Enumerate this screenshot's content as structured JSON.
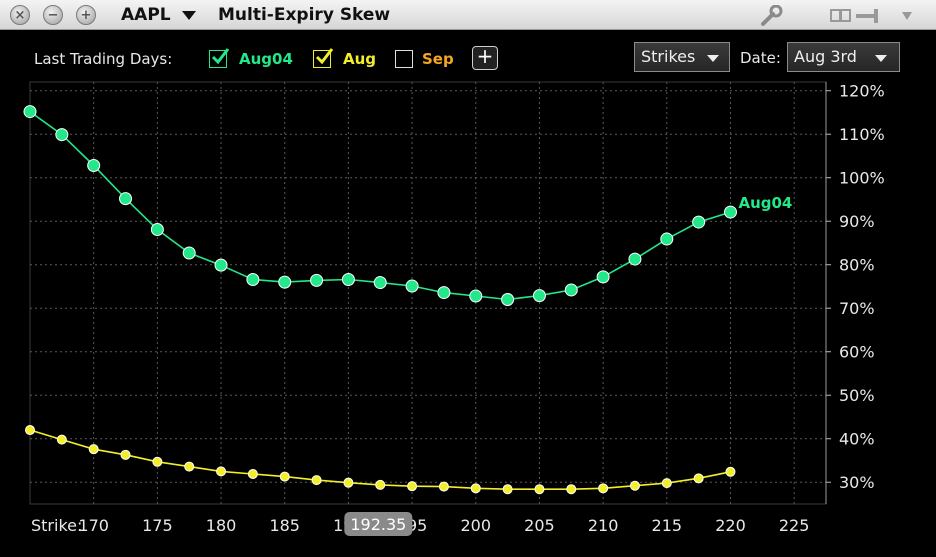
{
  "window": {
    "symbol": "AAPL",
    "title": "Multi-Expiry Skew"
  },
  "toolbar": {
    "last_trading_days_label": "Last Trading Days:",
    "expiries": [
      {
        "label": "Aug04",
        "checked": true,
        "color": "#22e88a"
      },
      {
        "label": "Aug",
        "checked": true,
        "color": "#f2ef2a"
      },
      {
        "label": "Sep",
        "checked": false,
        "color": "#f5a623"
      }
    ],
    "add_label": "+",
    "strikes_dropdown": "Strikes",
    "date_label": "Date:",
    "date_dropdown": "Aug 3rd"
  },
  "chart_data": {
    "type": "line",
    "title": "",
    "xlabel": "Strike:",
    "ylabel": "",
    "xlim": [
      165,
      227.5
    ],
    "ylim": [
      25,
      122
    ],
    "x_ticks": [
      170,
      175,
      180,
      185,
      190,
      195,
      200,
      205,
      210,
      215,
      220,
      225
    ],
    "y_ticks": [
      30,
      40,
      50,
      60,
      70,
      80,
      90,
      100,
      110,
      120
    ],
    "y_tick_suffix": "%",
    "grid": true,
    "current_price_label": "192.35",
    "current_price": 192.35,
    "series": [
      {
        "name": "Aug04",
        "color": "#22e88a",
        "label_at_end": true,
        "x": [
          165,
          167.5,
          170,
          172.5,
          175,
          177.5,
          180,
          182.5,
          185,
          187.5,
          190,
          192.5,
          195,
          197.5,
          200,
          202.5,
          205,
          207.5,
          210,
          212.5,
          215,
          217.5,
          220
        ],
        "y": [
          115.2,
          109.9,
          102.8,
          95.2,
          88.1,
          82.7,
          79.9,
          76.6,
          76.0,
          76.4,
          76.6,
          75.9,
          75.1,
          73.6,
          72.8,
          72.0,
          72.9,
          74.2,
          77.2,
          81.3,
          85.9,
          89.8,
          92.1
        ]
      },
      {
        "color": "#f2ef2a",
        "label_at_end": false,
        "x": [
          165,
          167.5,
          170,
          172.5,
          175,
          177.5,
          180,
          182.5,
          185,
          187.5,
          190,
          192.5,
          195,
          197.5,
          200,
          202.5,
          205,
          207.5,
          210,
          212.5,
          215,
          217.5,
          220
        ],
        "y": [
          42.0,
          39.8,
          37.6,
          36.3,
          34.7,
          33.6,
          32.5,
          31.9,
          31.3,
          30.5,
          29.9,
          29.4,
          29.1,
          29.0,
          28.6,
          28.4,
          28.4,
          28.4,
          28.6,
          29.2,
          29.8,
          30.9,
          32.4
        ]
      }
    ]
  }
}
